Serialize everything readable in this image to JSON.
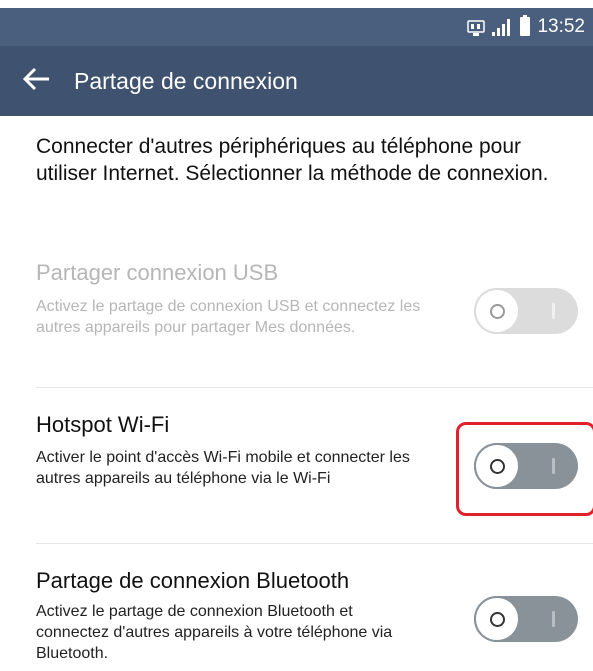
{
  "status_bar": {
    "time": "13:52",
    "icons": [
      "data-4g-icon",
      "signal-icon",
      "battery-icon"
    ]
  },
  "app_bar": {
    "back_icon": "arrow-left-icon",
    "title": "Partage de connexion"
  },
  "intro": "Connecter d'autres périphériques au téléphone pour utiliser Internet. Sélectionner la méthode de connexion.",
  "options": [
    {
      "title": "Partager connexion USB",
      "description": "Activez le partage de connexion USB et connectez les autres appareils pour partager Mes données.",
      "enabled": false,
      "toggle_on": false
    },
    {
      "title": "Hotspot Wi-Fi",
      "description": "Activer le point d'accès Wi-Fi mobile et connecter les autres appareils au téléphone via le Wi-Fi",
      "enabled": true,
      "toggle_on": false,
      "highlighted": true
    },
    {
      "title": "Partage de connexion Bluetooth",
      "description": "Activez le partage de connexion Bluetooth et connectez d'autres appareils à votre téléphone via Bluetooth.",
      "enabled": true,
      "toggle_on": false
    }
  ],
  "colors": {
    "status_bar": "#4a5e7e",
    "app_bar": "#3f526f",
    "highlight": "#e0202a"
  }
}
